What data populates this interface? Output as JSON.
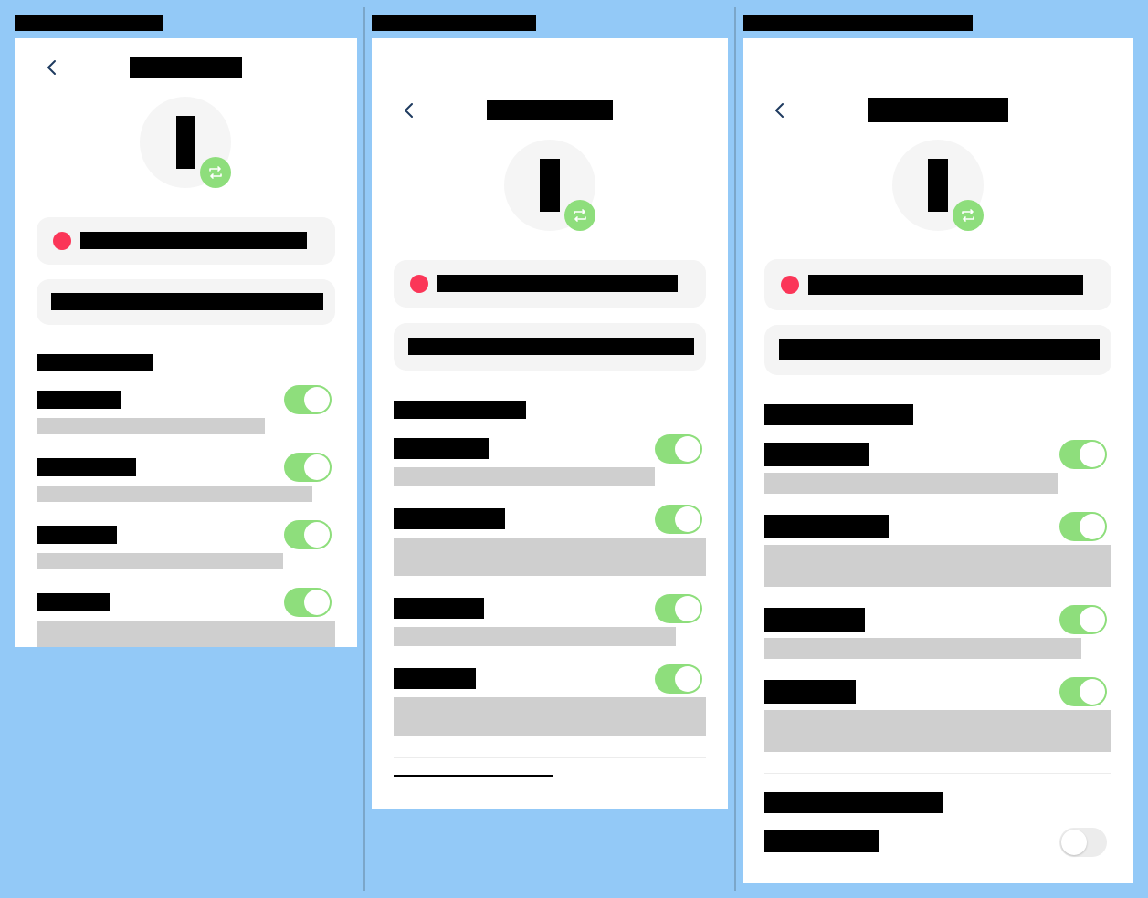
{
  "screens": [
    {
      "frame_label": "",
      "header_title": "",
      "avatar_initial": "",
      "status_text": "",
      "input_value": "",
      "section_title": "",
      "settings": [
        {
          "label": "",
          "description": "",
          "enabled": true
        },
        {
          "label": "",
          "description": "",
          "enabled": true
        },
        {
          "label": "",
          "description": "",
          "enabled": true
        },
        {
          "label": "",
          "description": "",
          "enabled": true
        }
      ]
    },
    {
      "frame_label": "",
      "header_title": "",
      "avatar_initial": "",
      "status_text": "",
      "input_value": "",
      "section_title": "",
      "settings": [
        {
          "label": "",
          "description": "",
          "enabled": true
        },
        {
          "label": "",
          "description": "",
          "enabled": true
        },
        {
          "label": "",
          "description": "",
          "enabled": true
        },
        {
          "label": "",
          "description": "",
          "enabled": true
        }
      ],
      "footer_link": ""
    },
    {
      "frame_label": "",
      "header_title": "",
      "avatar_initial": "",
      "status_text": "",
      "input_value": "",
      "section_title": "",
      "settings": [
        {
          "label": "",
          "description": "",
          "enabled": true
        },
        {
          "label": "",
          "description": "",
          "enabled": true
        },
        {
          "label": "",
          "description": "",
          "enabled": true
        },
        {
          "label": "",
          "description": "",
          "enabled": true
        }
      ],
      "second_section_title": "",
      "second_settings": [
        {
          "label": "",
          "enabled": false
        }
      ]
    }
  ],
  "icons": {
    "back": "chevron-left-icon",
    "swap": "swap-arrows-icon"
  },
  "colors": {
    "background": "#93c9f7",
    "toggle_on": "#8ede7c",
    "toggle_off": "#ececec",
    "status_dot": "#fb3658",
    "placeholder_grey": "#cfcfcf"
  }
}
